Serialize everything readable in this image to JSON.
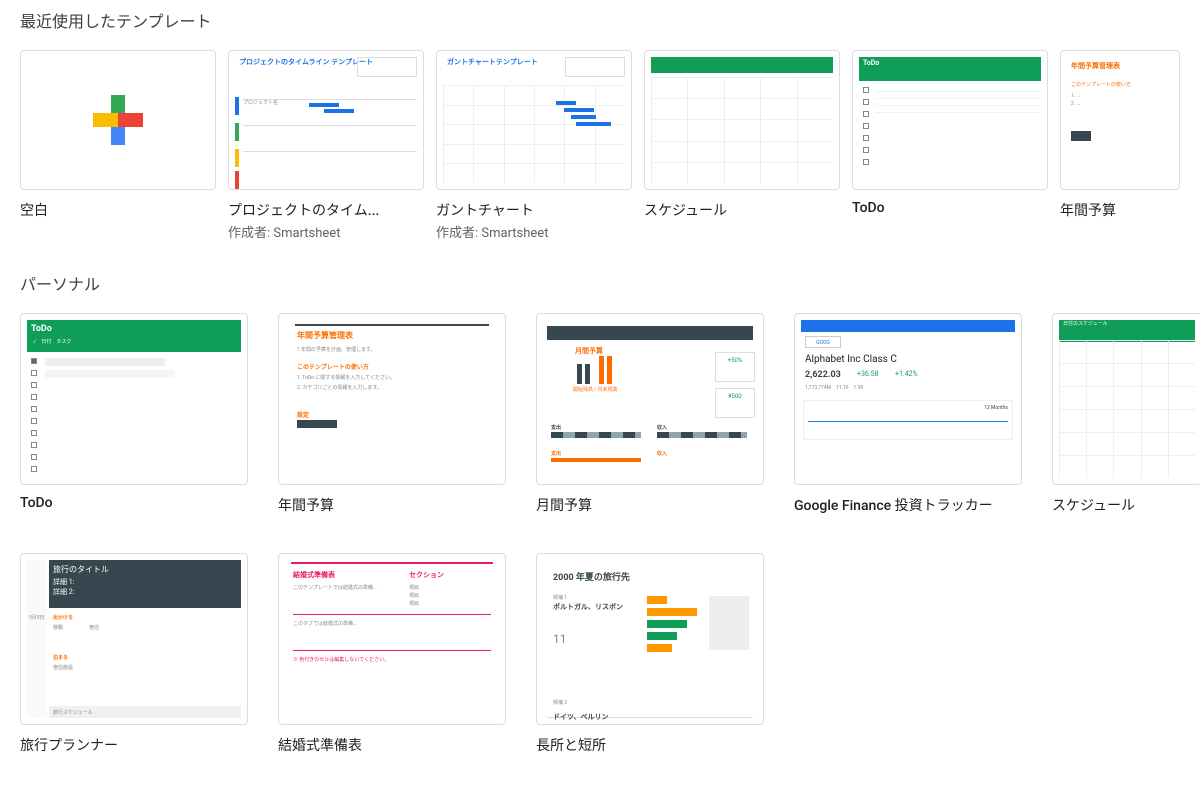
{
  "sections": [
    {
      "title": "最近使用したテンプレート",
      "layout": "row",
      "templates": [
        {
          "id": "blank",
          "title": "空白",
          "thumb": "blank"
        },
        {
          "id": "project-timeline",
          "title": "プロジェクトのタイム...",
          "subtitle": "作成者: Smartsheet",
          "thumb": "project-timeline",
          "thumb_title": "プロジェクトのタイムライン テンプレート"
        },
        {
          "id": "gantt-chart",
          "title": "ガントチャート",
          "subtitle": "作成者: Smartsheet",
          "thumb": "gantt",
          "thumb_title": "ガントチャートテンプレート"
        },
        {
          "id": "schedule",
          "title": "スケジュール",
          "thumb": "schedule-green"
        },
        {
          "id": "todo",
          "title": "ToDo",
          "thumb": "todo-green",
          "thumb_title": "ToDo"
        },
        {
          "id": "annual-budget",
          "title": "年間予算",
          "thumb": "annual-budget",
          "thumb_title": "年間予算管理表"
        }
      ]
    },
    {
      "title": "パーソナル",
      "layout": "wide",
      "templates": [
        {
          "id": "todo-p",
          "title": "ToDo",
          "thumb": "todo-green-wide",
          "thumb_title": "ToDo"
        },
        {
          "id": "annual-budget-p",
          "title": "年間予算",
          "thumb": "annual-budget-wide",
          "thumb_title": "年間予算管理表",
          "thumb_sub": "このテンプレートの使い方"
        },
        {
          "id": "monthly-budget",
          "title": "月間予算",
          "thumb": "monthly-budget",
          "thumb_title": "月間予算",
          "stat1": "+50%",
          "stat2": "¥500"
        },
        {
          "id": "gfinance",
          "title": "Google Finance 投資トラッカー",
          "thumb": "gfinance",
          "stock_name": "Alphabet Inc Class C",
          "price": "2,622.03",
          "change1": "+36.58",
          "change2": "+1.42%"
        },
        {
          "id": "schedule-p",
          "title": "スケジュール",
          "thumb": "schedule-wide"
        },
        {
          "id": "travel-planner",
          "title": "旅行プランナー",
          "thumb": "travel",
          "thumb_title": "旅行のタイトル"
        },
        {
          "id": "wedding",
          "title": "結婚式準備表",
          "thumb": "wedding",
          "thumb_title": "結婚式準備表",
          "thumb_col2": "セクション"
        },
        {
          "id": "pros-cons",
          "title": "長所と短所",
          "thumb": "pros-cons",
          "thumb_title": "2000 年夏の旅行先",
          "item1": "ポルトガル、リスボン",
          "item2": "ドイツ、ベルリン",
          "num": "11"
        }
      ]
    }
  ]
}
